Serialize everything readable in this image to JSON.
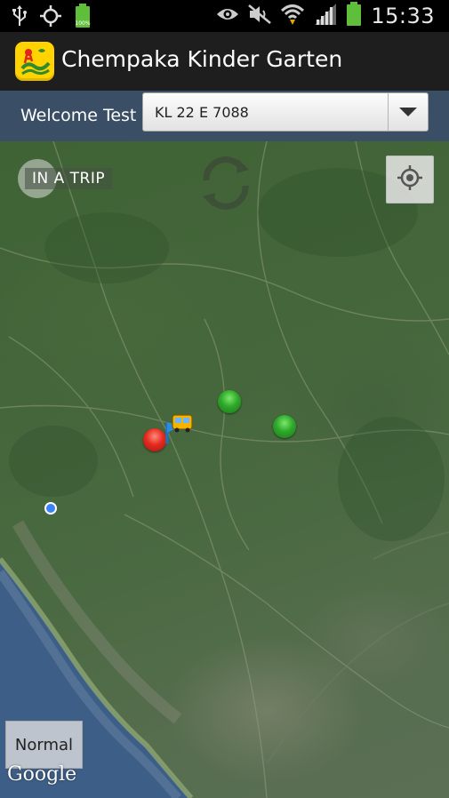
{
  "status_bar": {
    "time": "15:33",
    "icons": [
      "usb-icon",
      "gps-icon",
      "battery-full-small-icon",
      "eye-icon",
      "mute-icon",
      "wifi-icon",
      "signal-icon",
      "battery-icon"
    ]
  },
  "app_bar": {
    "title": "Chempaka Kinder Garten",
    "icon": "chempaka-app-icon",
    "icon_color": "#ffd200"
  },
  "welcome_bar": {
    "welcome_text": "Welcome Test",
    "vehicle_select": {
      "selected": "KL 22 E 7088"
    }
  },
  "map": {
    "status_label": "IN A TRIP",
    "map_type_label": "Normal",
    "attribution": "Google",
    "markers": [
      "stop-green",
      "stop-green",
      "stop-red",
      "bus",
      "my-location"
    ],
    "colors": {
      "stop_green": "#2ea82a",
      "stop_red": "#e42b1f",
      "my_location": "#3b82f6",
      "sea": "#3d5e86"
    }
  }
}
